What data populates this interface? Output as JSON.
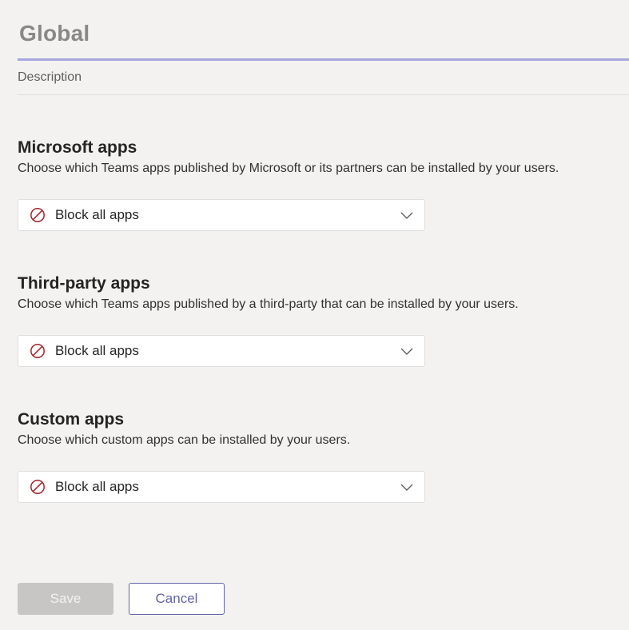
{
  "policy": {
    "name": "Global",
    "description_placeholder": "Description"
  },
  "sections": [
    {
      "heading": "Microsoft apps",
      "subtext": "Choose which Teams apps published by Microsoft or its partners can be installed by your users.",
      "dropdown_value": "Block all apps",
      "icon": "block-icon"
    },
    {
      "heading": "Third-party apps",
      "subtext": "Choose which Teams apps published by a third-party that can be installed by your users.",
      "dropdown_value": "Block all apps",
      "icon": "block-icon"
    },
    {
      "heading": "Custom apps",
      "subtext": "Choose which custom apps can be installed by your users.",
      "dropdown_value": "Block all apps",
      "icon": "block-icon"
    }
  ],
  "actions": {
    "save_label": "Save",
    "cancel_label": "Cancel"
  },
  "colors": {
    "accent": "#6264a7",
    "block_icon": "#a4262c",
    "background": "#f3f2f1"
  }
}
